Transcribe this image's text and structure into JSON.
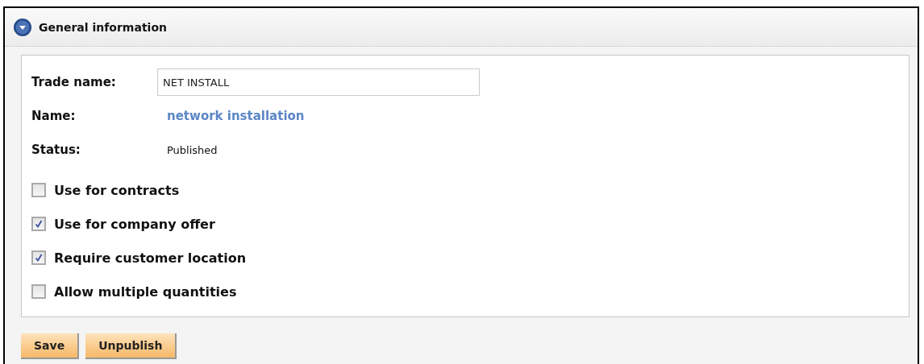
{
  "panel": {
    "title": "General information",
    "expanded": true
  },
  "fields": [
    {
      "kind": "input",
      "label": "Trade name:",
      "value": "NET INSTALL"
    },
    {
      "kind": "link",
      "label": "Name:",
      "value": "network installation"
    },
    {
      "kind": "text",
      "label": "Status:",
      "value": "Published"
    }
  ],
  "options": [
    {
      "label": "Use for contracts",
      "checked": false
    },
    {
      "label": "Use for company offer",
      "checked": true
    },
    {
      "label": "Require customer location",
      "checked": true
    },
    {
      "label": "Allow multiple quantities",
      "checked": false
    }
  ],
  "buttons": [
    "Save",
    "Unpublish"
  ]
}
